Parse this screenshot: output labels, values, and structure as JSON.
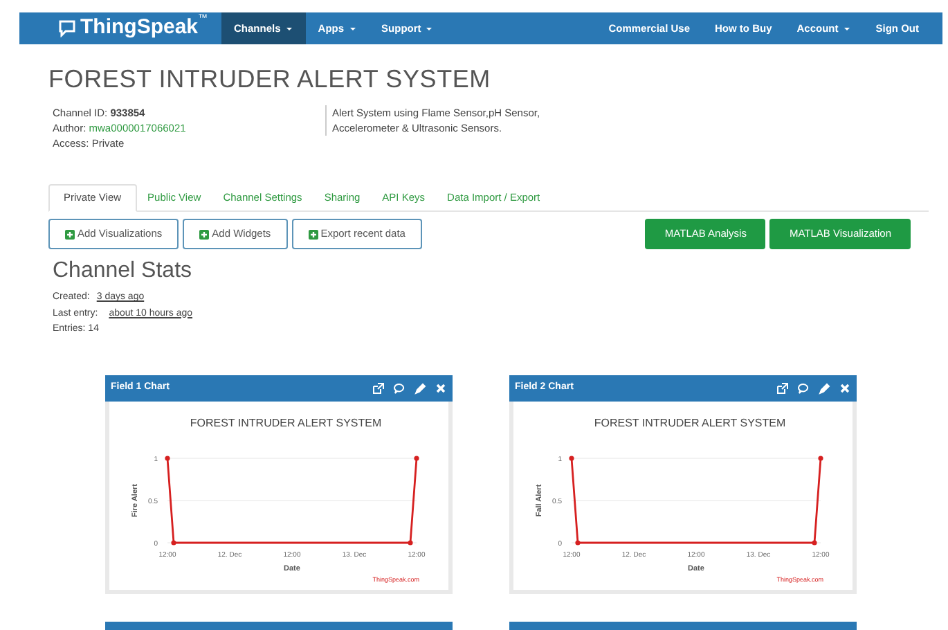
{
  "navbar": {
    "brand": "ThingSpeak",
    "brand_mark": "™",
    "left_items": [
      {
        "label": "Channels",
        "dropdown": true,
        "selected": true
      },
      {
        "label": "Apps",
        "dropdown": true,
        "selected": false
      },
      {
        "label": "Support",
        "dropdown": true,
        "selected": false
      }
    ],
    "right_items": [
      {
        "label": "Commercial Use",
        "dropdown": false
      },
      {
        "label": "How to Buy",
        "dropdown": false
      },
      {
        "label": "Account",
        "dropdown": true
      },
      {
        "label": "Sign Out",
        "dropdown": false
      }
    ]
  },
  "channel": {
    "title": "FOREST INTRUDER ALERT SYSTEM",
    "id_label": "Channel ID:",
    "id": "933854",
    "author_label": "Author:",
    "author": "mwa0000017066021",
    "access": "Access: Private",
    "description": "Alert System using Flame Sensor,pH Sensor, Accelerometer & Ultrasonic Sensors."
  },
  "tabs": [
    {
      "label": "Private View",
      "selected": true
    },
    {
      "label": "Public View",
      "selected": false
    },
    {
      "label": "Channel Settings",
      "selected": false
    },
    {
      "label": "Sharing",
      "selected": false
    },
    {
      "label": "API Keys",
      "selected": false
    },
    {
      "label": "Data Import / Export",
      "selected": false
    }
  ],
  "actions": [
    {
      "label": "Add Visualizations",
      "kind": "outline"
    },
    {
      "label": "Add Widgets",
      "kind": "outline"
    },
    {
      "label": "Export recent data",
      "kind": "outline"
    },
    {
      "label": "MATLAB Analysis",
      "kind": "solid"
    },
    {
      "label": "MATLAB Visualization",
      "kind": "solid"
    }
  ],
  "stats": {
    "heading": "Channel Stats",
    "created_label": "Created:",
    "created": "3 days ago",
    "last_entry_label": "Last entry:",
    "last_entry": "about 10 hours ago",
    "entries": "Entries: 14"
  },
  "charts": [
    {
      "header": "Field 1 Chart",
      "chart_data": {
        "type": "line",
        "title": "FOREST INTRUDER ALERT SYSTEM",
        "xlabel": "Date",
        "ylabel": "Fire Alert",
        "categories": [
          "12:00",
          null,
          null,
          null,
          null,
          null,
          null,
          null,
          null,
          null,
          "12. Dec",
          null,
          null,
          null,
          null,
          null,
          null,
          null,
          null,
          null,
          "12:00",
          null,
          null,
          null,
          null,
          null,
          null,
          null,
          null,
          null,
          "13. Dec",
          null,
          null,
          null,
          null,
          null,
          null,
          null,
          null,
          null,
          "12:00"
        ],
        "series": [
          {
            "color": "#d62020",
            "marker": true,
            "values": [
              1,
              0,
              0,
              0,
              0,
              0,
              0,
              0,
              0,
              0,
              0,
              0,
              0,
              0,
              0,
              0,
              0,
              0,
              0,
              0,
              0,
              0,
              0,
              0,
              0,
              0,
              0,
              0,
              0,
              0,
              0,
              0,
              0,
              0,
              0,
              0,
              0,
              0,
              0,
              0,
              1
            ]
          }
        ],
        "ylim": [
          0,
          1
        ],
        "yticks": [
          0,
          0.5,
          1
        ]
      },
      "credit": "ThingSpeak.com"
    },
    {
      "header": "Field 2 Chart",
      "chart_data": {
        "type": "line",
        "title": "FOREST INTRUDER ALERT SYSTEM",
        "xlabel": "Date",
        "ylabel": "Fall Alert",
        "categories": [
          "12:00",
          null,
          null,
          null,
          null,
          null,
          null,
          null,
          null,
          null,
          "12. Dec",
          null,
          null,
          null,
          null,
          null,
          null,
          null,
          null,
          null,
          "12:00",
          null,
          null,
          null,
          null,
          null,
          null,
          null,
          null,
          null,
          "13. Dec",
          null,
          null,
          null,
          null,
          null,
          null,
          null,
          null,
          null,
          "12:00"
        ],
        "series": [
          {
            "color": "#d62020",
            "marker": true,
            "values": [
              1,
              0,
              0,
              0,
              0,
              0,
              0,
              0,
              0,
              0,
              0,
              0,
              0,
              0,
              0,
              0,
              0,
              0,
              0,
              0,
              0,
              0,
              0,
              0,
              0,
              0,
              0,
              0,
              0,
              0,
              0,
              0,
              0,
              0,
              0,
              0,
              0,
              0,
              0,
              0,
              1
            ]
          }
        ],
        "ylim": [
          0,
          1
        ],
        "yticks": [
          0,
          0.5,
          1
        ]
      },
      "credit": "ThingSpeak.com"
    }
  ]
}
